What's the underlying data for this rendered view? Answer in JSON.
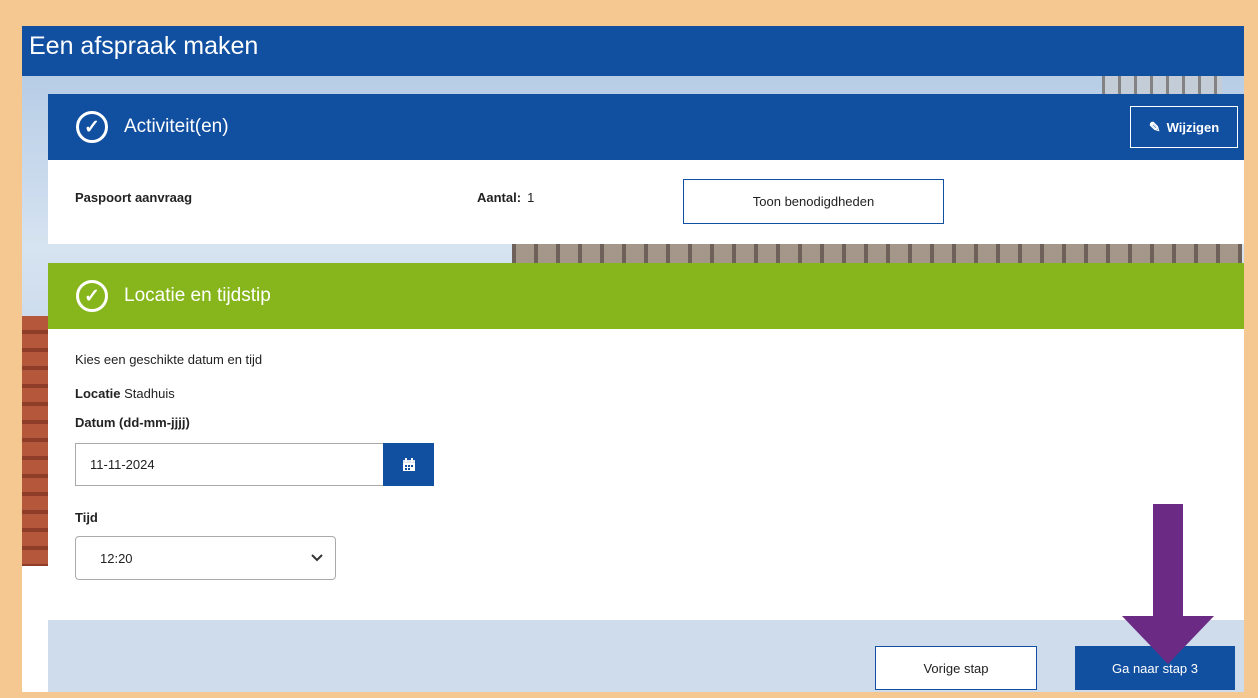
{
  "page": {
    "title": "Een afspraak maken"
  },
  "step1": {
    "header": "Activiteit(en)",
    "edit_label": "Wijzigen",
    "item_name": "Paspoort aanvraag",
    "count_label": "Aantal:",
    "count_value": "1",
    "requirements_button": "Toon benodigdheden"
  },
  "step2": {
    "header": "Locatie en tijdstip",
    "intro": "Kies een geschikte datum en tijd",
    "location_label": "Locatie",
    "location_value": "Stadhuis",
    "date_label": "Datum (dd-mm-jjjj)",
    "date_value": "11-11-2024",
    "time_label": "Tijd",
    "time_value": "12:20"
  },
  "footer": {
    "prev_label": "Vorige stap",
    "next_label": "Ga naar stap 3"
  },
  "colors": {
    "primary_blue": "#114fa1",
    "step_green": "#86b61b",
    "frame_orange": "#f5c891",
    "annotation_arrow": "#6b2a83"
  },
  "icons": [
    "check-circle-icon",
    "pencil-icon",
    "calendar-icon",
    "chevron-down-icon",
    "arrow-down-icon"
  ]
}
